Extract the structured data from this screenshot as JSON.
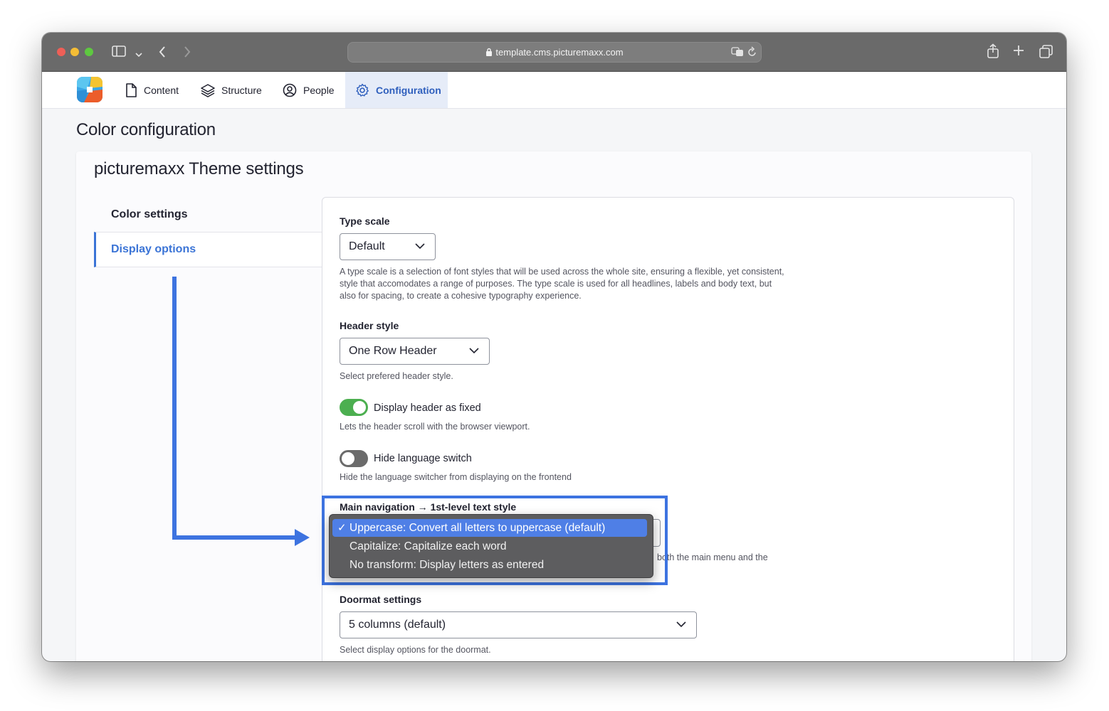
{
  "browser": {
    "url": "template.cms.picturemaxx.com"
  },
  "toolbar": {
    "items": [
      {
        "label": "Content",
        "icon": "file-icon"
      },
      {
        "label": "Structure",
        "icon": "layers-icon"
      },
      {
        "label": "People",
        "icon": "user-circle-icon"
      },
      {
        "label": "Configuration",
        "icon": "gear-icon",
        "active": true
      }
    ]
  },
  "page": {
    "title": "Color configuration",
    "card_title": "picturemaxx Theme settings"
  },
  "tabs": [
    {
      "label": "Color settings"
    },
    {
      "label": "Display options",
      "active": true
    }
  ],
  "form": {
    "type_scale": {
      "label": "Type scale",
      "value": "Default",
      "description": "A type scale is a selection of font styles that will be used across the whole site, ensuring a flexible, yet consistent, style that accomodates a range of purposes. The type scale is used for all headlines, labels and body text, but also for spacing, to create a cohesive typography experience."
    },
    "header_style": {
      "label": "Header style",
      "value": "One Row Header",
      "description": "Select prefered header style."
    },
    "fixed_header": {
      "label": "Display header as fixed",
      "checked": true,
      "description": "Lets the header scroll with the browser viewport."
    },
    "language_switch": {
      "label": "Hide language switch",
      "checked": false,
      "description": "Hide the language switcher from displaying on the frontend"
    },
    "main_nav": {
      "label": "Main navigation → 1st-level text style",
      "partial_description": "both the main menu and the",
      "options": [
        {
          "label": "Uppercase: Convert all letters to uppercase (default)",
          "selected": true
        },
        {
          "label": "Capitalize: Capitalize each word",
          "selected": false
        },
        {
          "label": "No transform: Display letters as entered",
          "selected": false
        }
      ],
      "checkmark": "✓"
    },
    "doormat": {
      "label": "Doormat settings",
      "value": "5 columns (default)",
      "description": "Select display options for the doormat."
    }
  },
  "colors": {
    "accent": "#3b74d6",
    "annotation": "#3d73e0",
    "toggle_on": "#4caf50",
    "toggle_off": "#6b6b6b"
  }
}
